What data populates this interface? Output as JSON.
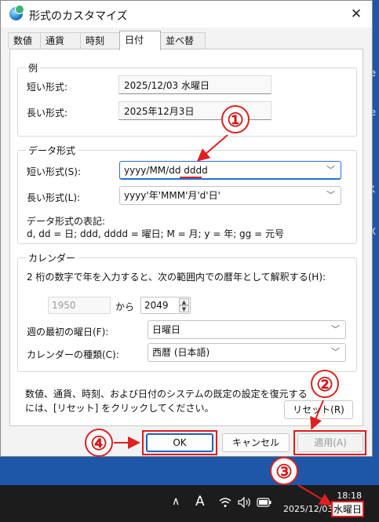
{
  "desktop": {
    "edge_chars": [
      "，",
      "e",
      "e",
      "ス",
      "X"
    ]
  },
  "window": {
    "title": "形式のカスタマイズ",
    "close_glyph": "✕"
  },
  "tabs": [
    {
      "label": "数値"
    },
    {
      "label": "通貨"
    },
    {
      "label": "時刻"
    },
    {
      "label": "日付"
    },
    {
      "label": "並べ替え"
    }
  ],
  "example": {
    "title": "例",
    "short_label": "短い形式:",
    "short_value": "2025/12/03 水曜日",
    "long_label": "長い形式:",
    "long_value": "2025年12月3日"
  },
  "date_format": {
    "title": "データ形式",
    "short_label": "短い形式(S):",
    "short_value": "yyyy/MM/dd dddd",
    "long_label": "長い形式(L):",
    "long_value": "yyyy'年'MMM'月'd'日'",
    "notation_title": "データ形式の表記:",
    "notation": "d, dd = 日;  ddd, dddd = 曜日; M = 月; y = 年; gg = 元号"
  },
  "calendar": {
    "title": "カレンダー",
    "description": "2 桁の数字で年を入力すると、次の範囲内での暦年として解釈する(H):",
    "from_year": "1950",
    "to_word": "から",
    "to_year": "2049",
    "first_day_label": "週の最初の曜日(F):",
    "first_day_value": "日曜日",
    "calendar_type_label": "カレンダーの種類(C):",
    "calendar_type_value": "西暦 (日本語)"
  },
  "reset": {
    "text_line1": "数値、通貨、時刻、および日付のシステムの既定の設定を復元する",
    "text_line2": "には、[リセット] をクリックしてください。",
    "button": "リセット(R)"
  },
  "buttons": {
    "ok": "OK",
    "cancel": "キャンセル",
    "apply": "適用(A)"
  },
  "annotations": {
    "n1": "①",
    "n2": "②",
    "n3": "③",
    "n4": "④",
    "color": "#e02020"
  },
  "taskbar": {
    "chevron": "∧",
    "ime": "A",
    "wifi_icon": "wifi-icon",
    "volume_icon": "volume-icon",
    "battery_icon": "battery-icon",
    "time": "18:18",
    "date": "2025/12/03",
    "weekday": "水曜日"
  }
}
